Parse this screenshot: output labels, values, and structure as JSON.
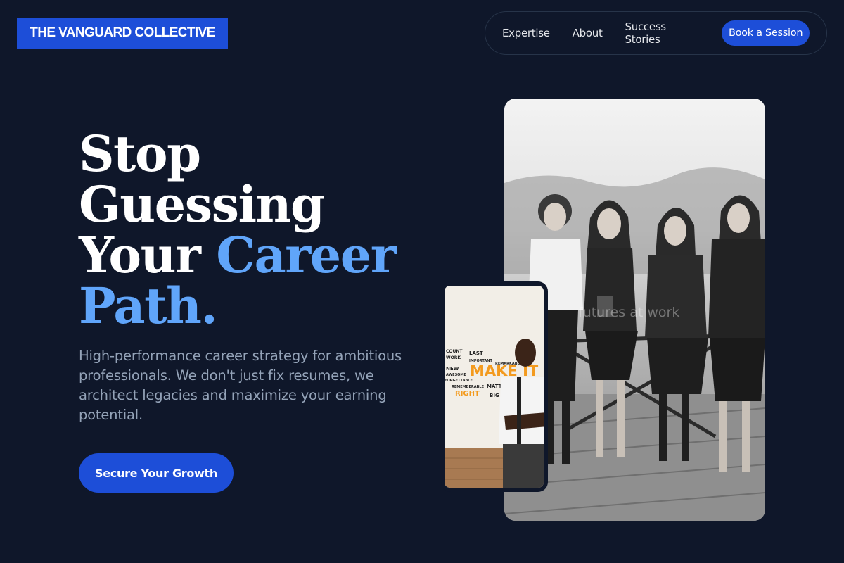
{
  "brand": {
    "name": "THE VANGUARD COLLECTIVE"
  },
  "nav": {
    "items": [
      "Expertise",
      "About",
      "Success Stories"
    ],
    "cta_label": "Book a Session"
  },
  "hero": {
    "headline_line1": "Stop",
    "headline_line2": "Guessing",
    "headline_line3_white": "Your ",
    "headline_line3_accent": "Career",
    "headline_line4_accent": "Path.",
    "subtext": "High-performance career strategy for ambitious professionals. We don't just fix resumes, we architect legacies and maximize your earning potential.",
    "cta_label": "Secure Your Growth"
  },
  "images": {
    "main_photo": "team-photo",
    "main_photo_watermark": "futures at work",
    "small_photo": "professional-photo",
    "small_photo_text": "MAKE IT"
  },
  "colors": {
    "background": "#0f172a",
    "primary": "#1d4ed8",
    "accent": "#60a5fa",
    "muted_text": "#94a3b8"
  }
}
